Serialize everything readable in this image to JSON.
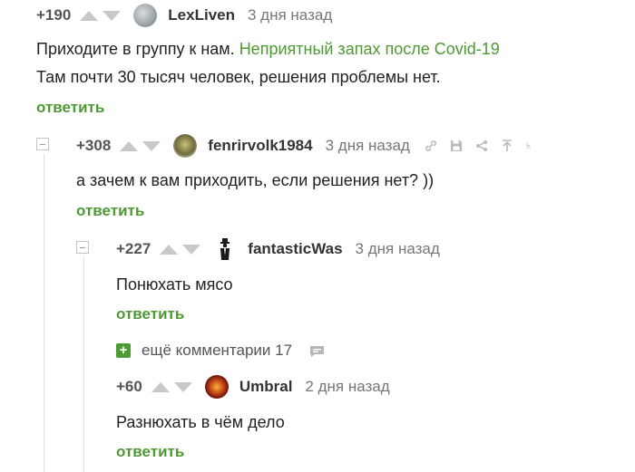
{
  "comments": [
    {
      "rating": "+190",
      "username": "LexLiven",
      "time": "3 дня назад",
      "text_lines": [
        "Приходите в группу к нам.",
        "Там почти 30 тысяч человек, решения проблемы нет."
      ],
      "link_text": "Неприятный запах после Covid-19",
      "reply_label": "ответить",
      "avatar_color": "#9aa3a8"
    },
    {
      "rating": "+308",
      "username": "fenrirvolk1984",
      "time": "3 дня назад",
      "text": "а зачем к вам приходить, если решения нет? ))",
      "reply_label": "ответить",
      "avatar_color": "#6f6a3a"
    },
    {
      "rating": "+227",
      "username": "fantasticWas",
      "time": "3 дня назад",
      "text": "Понюхать мясо",
      "reply_label": "ответить",
      "avatar_color": "#1a1a1a"
    },
    {
      "rating": "+60",
      "username": "Umbral",
      "time": "2 дня назад",
      "text": "Разнюхать в чём дело",
      "reply_label": "ответить",
      "avatar_color": "#c0392b"
    }
  ],
  "more_comments": {
    "label": "ещё комментарии 17",
    "plus": "+"
  },
  "colors": {
    "accent": "#4d9932",
    "arrow": "#c8c8c8",
    "muted": "#777777"
  },
  "icons": [
    "link-icon",
    "save-icon",
    "share-icon",
    "go-to-parent-icon",
    "more-icon",
    "speech-bubble-icon"
  ]
}
